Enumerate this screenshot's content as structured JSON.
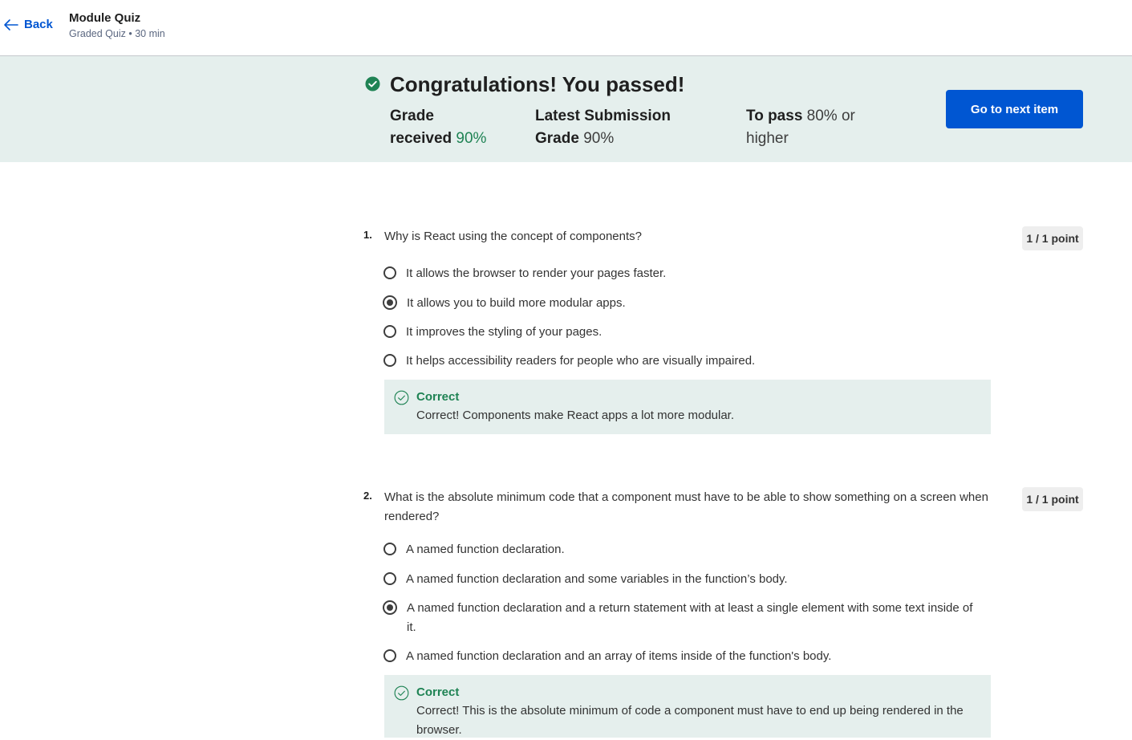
{
  "header": {
    "back_label": "Back",
    "title": "Module Quiz",
    "subtitle": "Graded Quiz • 30 min"
  },
  "result": {
    "headline": "Congratulations! You passed!",
    "grade_label_1": "Grade",
    "grade_label_2": "received",
    "grade_value": "90%",
    "latest_label_1": "Latest Submission",
    "latest_label_2": "Grade",
    "latest_value": "90%",
    "pass_label": "To pass",
    "pass_value_1": "80% or",
    "pass_value_2": "higher",
    "next_button": "Go to next item",
    "colors": {
      "success": "#1f8354",
      "accent": "#0056d2",
      "banner_bg": "#e5efed"
    }
  },
  "questions": [
    {
      "number": "1.",
      "text": "Why is React using the concept of components?",
      "points": "1 / 1 point",
      "options": [
        {
          "label": "It allows the browser to render your pages faster.",
          "selected": false
        },
        {
          "label": "It allows you to build more modular apps.",
          "selected": true
        },
        {
          "label": "It improves the styling of your pages.",
          "selected": false
        },
        {
          "label": "It helps accessibility readers for people who are visually impaired.",
          "selected": false
        }
      ],
      "feedback": {
        "title": "Correct",
        "text": "Correct! Components make React apps a lot more modular."
      }
    },
    {
      "number": "2.",
      "text": "What is the absolute minimum code that a component must have to be able to show something on a screen when rendered?",
      "points": "1 / 1 point",
      "options": [
        {
          "label": "A named function declaration.",
          "selected": false
        },
        {
          "label": "A named function declaration and some variables in the function’s body.",
          "selected": false
        },
        {
          "label": "A named function declaration and a return statement with at least a single element with some text inside of it.",
          "selected": true
        },
        {
          "label": "A named function declaration and an array of items inside of the function's body.",
          "selected": false
        }
      ],
      "feedback": {
        "title": "Correct",
        "text": "Correct! This is the absolute minimum of code a component must have to end up being rendered in the browser."
      }
    }
  ]
}
